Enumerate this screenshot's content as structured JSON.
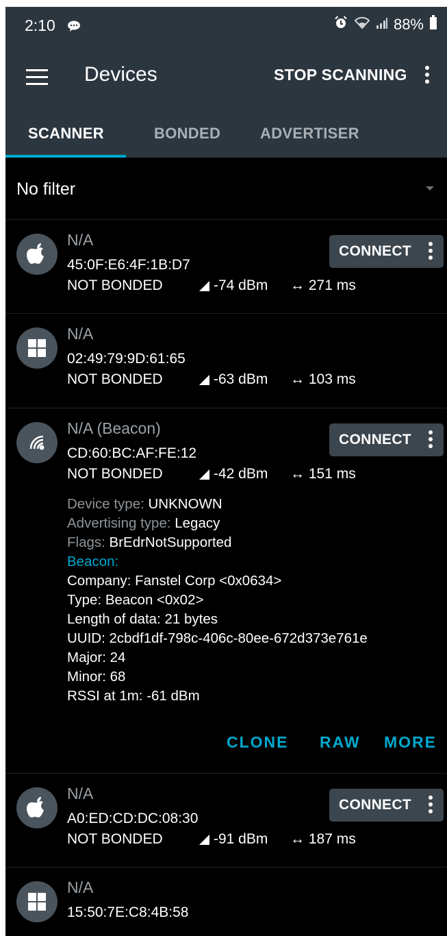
{
  "status_bar": {
    "time": "2:10",
    "battery": "88%"
  },
  "toolbar": {
    "title": "Devices",
    "stop_label": "STOP SCANNING"
  },
  "tabs": [
    {
      "label": "SCANNER",
      "active": true
    },
    {
      "label": "BONDED",
      "active": false
    },
    {
      "label": "ADVERTISER",
      "active": false
    }
  ],
  "filter": {
    "label": "No filter"
  },
  "connect_label": "CONNECT",
  "devices": [
    {
      "icon": "apple-icon",
      "name": "N/A",
      "address": "45:0F:E6:4F:1B:D7",
      "bond": "NOT BONDED",
      "rssi": "-74 dBm",
      "interval": "↔ 271 ms",
      "connectable": true
    },
    {
      "icon": "windows-icon",
      "name": "N/A",
      "address": "02:49:79:9D:61:65",
      "bond": "NOT BONDED",
      "rssi": "-63 dBm",
      "interval": "↔ 103 ms",
      "connectable": false
    },
    {
      "icon": "beacon-icon",
      "name": "N/A  (Beacon)",
      "address": "CD:60:BC:AF:FE:12",
      "bond": "NOT BONDED",
      "rssi": "-42 dBm",
      "interval": "↔ 151 ms",
      "connectable": true,
      "details": {
        "device_type_key": "Device type: ",
        "device_type": "UNKNOWN",
        "adv_type_key": "Advertising type: ",
        "adv_type": "Legacy",
        "flags_key": "Flags: ",
        "flags": "BrEdrNotSupported",
        "beacon_head": "Beacon:",
        "lines": [
          "Company: Fanstel Corp <0x0634>",
          "Type: Beacon <0x02>",
          "Length of data: 21 bytes",
          "UUID: 2cbdf1df-798c-406c-80ee-672d373e761e",
          "Major: 24",
          "Minor: 68",
          "RSSI at 1m: -61 dBm"
        ]
      },
      "actions": {
        "clone": "CLONE",
        "raw": "RAW",
        "more": "MORE"
      }
    },
    {
      "icon": "apple-icon",
      "name": "N/A",
      "address": "A0:ED:CD:DC:08:30",
      "bond": "NOT BONDED",
      "rssi": "-91 dBm",
      "interval": "↔ 187 ms",
      "connectable": true
    },
    {
      "icon": "windows-icon",
      "name": "N/A",
      "address": "15:50:7E:C8:4B:58"
    }
  ]
}
